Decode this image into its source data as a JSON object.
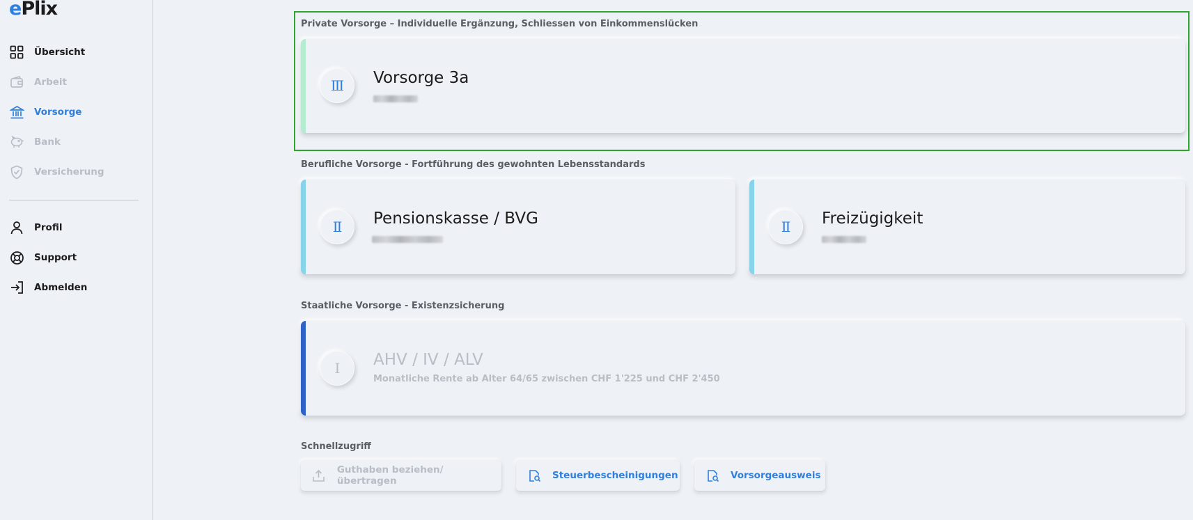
{
  "logo": {
    "e": "e",
    "rest": "Plix"
  },
  "nav": {
    "items": [
      {
        "label": "Übersicht",
        "icon": "grid-icon",
        "state": "normal"
      },
      {
        "label": "Arbeit",
        "icon": "wallet-icon",
        "state": "disabled"
      },
      {
        "label": "Vorsorge",
        "icon": "bank-icon",
        "state": "active"
      },
      {
        "label": "Bank",
        "icon": "piggy-bank-icon",
        "state": "disabled"
      },
      {
        "label": "Versicherung",
        "icon": "shield-check-icon",
        "state": "disabled"
      }
    ],
    "secondary": [
      {
        "label": "Profil",
        "icon": "user-icon"
      },
      {
        "label": "Support",
        "icon": "lifebuoy-icon"
      },
      {
        "label": "Abmelden",
        "icon": "logout-icon"
      }
    ]
  },
  "sections": {
    "private": {
      "title": "Private Vorsorge – Individuelle Ergänzung, Schliessen von Einkommenslücken",
      "cards": [
        {
          "pillar": "Ⅲ",
          "title": "Vorsorge 3a"
        }
      ]
    },
    "occupational": {
      "title": "Berufliche Vorsorge - Fortführung des gewohnten Lebensstandards",
      "cards": [
        {
          "pillar": "Ⅱ",
          "title": "Pensionskasse / BVG"
        },
        {
          "pillar": "Ⅱ",
          "title": "Freizügigkeit"
        }
      ]
    },
    "state": {
      "title": "Staatliche Vorsorge - Existenzsicherung",
      "cards": [
        {
          "pillar": "Ⅰ",
          "title": "AHV / IV / ALV",
          "subtitle": "Monatliche Rente ab Alter 64/65 zwischen CHF 1'225 und CHF 2'450"
        }
      ]
    },
    "quick": {
      "title": "Schnellzugriff",
      "buttons": [
        {
          "label": "Guthaben beziehen/übertragen",
          "icon": "upload-icon",
          "state": "disabled"
        },
        {
          "label": "Steuerbescheinigungen",
          "icon": "document-search-icon",
          "state": "normal"
        },
        {
          "label": "Vorsorgeausweis",
          "icon": "document-search-icon",
          "state": "normal"
        }
      ]
    }
  },
  "colors": {
    "accent": "#2f7fe0",
    "pillar3": "#b3ecd0",
    "pillar2": "#86d3ea",
    "pillar1": "#2e62c7",
    "highlight": "#2fa52f"
  }
}
